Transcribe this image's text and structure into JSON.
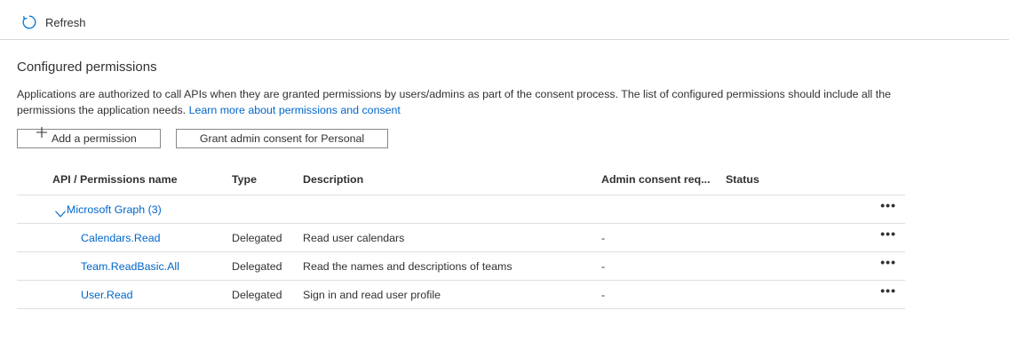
{
  "toolbar": {
    "refresh_label": "Refresh"
  },
  "section": {
    "title": "Configured permissions",
    "description": "Applications are authorized to call APIs when they are granted permissions by users/admins as part of the consent process. The list of configured permissions should include all the permissions the application needs.",
    "learn_more": "Learn more about permissions and consent"
  },
  "actions": {
    "add_permission": "Add a permission",
    "grant_consent": "Grant admin consent for Personal"
  },
  "table": {
    "columns": [
      "API / Permissions name",
      "Type",
      "Description",
      "Admin consent req...",
      "Status"
    ],
    "group": {
      "name": "Microsoft Graph (3)",
      "more": "•••"
    },
    "rows": [
      {
        "name": "Calendars.Read",
        "type": "Delegated",
        "description": "Read user calendars",
        "admin_consent": "-",
        "status": "",
        "more": "•••"
      },
      {
        "name": "Team.ReadBasic.All",
        "type": "Delegated",
        "description": "Read the names and descriptions of teams",
        "admin_consent": "-",
        "status": "",
        "more": "•••"
      },
      {
        "name": "User.Read",
        "type": "Delegated",
        "description": "Sign in and read user profile",
        "admin_consent": "-",
        "status": "",
        "more": "•••"
      }
    ]
  },
  "icons": {
    "refresh": "refresh-icon",
    "add": "plus-icon",
    "chevron": "chevron-down-icon",
    "more": "more-icon"
  },
  "colors": {
    "link": "#0066cc",
    "accent": "#0078d4",
    "border": "#e1dfdd",
    "text": "#323130"
  }
}
